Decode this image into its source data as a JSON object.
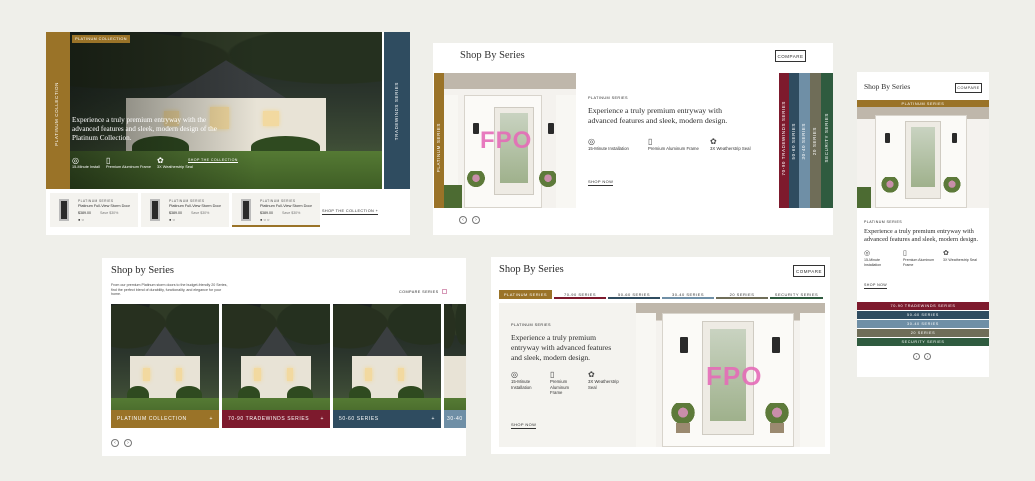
{
  "colors": {
    "platinum": "#9a7328",
    "seventy_ninety": "#7d1a2d",
    "fifty_sixty": "#2f4c60",
    "thirty_forty": "#6f8fa6",
    "twenty": "#6f6d58",
    "security": "#2f5b3f",
    "background": "#efefea"
  },
  "card1": {
    "badge": "PLATINUM COLLECTION",
    "side_label": "PLATINUM COLLECTION",
    "right_label": "TRADEWINDS SERIES",
    "headline": "Experience a truly premium entryway with the advanced features and sleek, modern design of the Platinum Collection.",
    "features": [
      {
        "icon": "timer-icon",
        "glyph": "◎",
        "label": "15-Minute Install"
      },
      {
        "icon": "frame-icon",
        "glyph": "▯",
        "label": "Premium Aluminum Frame"
      },
      {
        "icon": "seal-icon",
        "glyph": "✿",
        "label": "3X Weatherstrip Seal"
      }
    ],
    "shop_link": "SHOP THE COLLECTION",
    "products": [
      {
        "eyebrow": "PLATINUM SERIES",
        "name": "Platinum Full-View Storm Door",
        "price": "$389.00",
        "was": "Save $30%"
      },
      {
        "eyebrow": "PLATINUM SERIES",
        "name": "Platinum Full-View Storm Door",
        "price": "$389.00",
        "was": "Save $30%"
      },
      {
        "eyebrow": "PLATINUM SERIES",
        "name": "Platinum Full-View Storm Door",
        "price": "$389.00",
        "was": "Save $30%"
      }
    ],
    "products_link": "SHOP THE COLLECTION +"
  },
  "card2": {
    "title": "Shop By Series",
    "compare": "COMPARE",
    "side_label": "PLATINUM SERIES",
    "fpo": "FPO",
    "eyebrow": "PLATINUM SERIES",
    "headline": "Experience a truly premium entryway with advanced features and sleek, modern design.",
    "features": [
      {
        "icon": "timer-icon",
        "glyph": "◎",
        "label": "15-Minute Installation"
      },
      {
        "icon": "frame-icon",
        "glyph": "▯",
        "label": "Premium Aluminum Frame"
      },
      {
        "icon": "seal-icon",
        "glyph": "✿",
        "label": "3X Weatherstrip Seal"
      }
    ],
    "shop": "SHOP NOW",
    "stripes": [
      "70-90 TRADEWINDS SERIES",
      "50-60 SERIES",
      "30-40 SERIES",
      "20 SERIES",
      "SECURITY SERIES"
    ]
  },
  "card3": {
    "title": "Shop By Series",
    "compare": "COMPARE",
    "bar_top": "PLATINUM SERIES",
    "eyebrow": "PLATINUM SERIES",
    "headline": "Experience a truly premium entryway with advanced features and sleek, modern design.",
    "features": [
      {
        "icon": "timer-icon",
        "glyph": "◎",
        "label": "15-Minute Installation"
      },
      {
        "icon": "frame-icon",
        "glyph": "▯",
        "label": "Premium Aluminum Frame"
      },
      {
        "icon": "seal-icon",
        "glyph": "✿",
        "label": "3X Weatherstrip Seal"
      }
    ],
    "shop": "SHOP NOW",
    "bars": [
      "70-90 TRADEWINDS SERIES",
      "50-60 SERIES",
      "30-40 SERIES",
      "20 SERIES",
      "SECURITY SERIES"
    ]
  },
  "card4": {
    "title": "Shop by Series",
    "subtitle": "From our premium Platinum storm doors to the budget-friendly 20 Series, find the perfect blend of durability, functionality, and elegance for your home.",
    "compare": "COMPARE SERIES",
    "tiles": [
      "PLATINUM COLLECTION",
      "70-90 TRADEWINDS SERIES",
      "50-60 SERIES",
      "30-40"
    ]
  },
  "card5": {
    "title": "Shop By Series",
    "compare": "COMPARE",
    "tabs": [
      "PLATINUM SERIES",
      "70-90 SERIES",
      "50-60 SERIES",
      "30-40 SERIES",
      "20 SERIES",
      "SECURITY SERIES"
    ],
    "eyebrow": "PLATINUM SERIES",
    "headline": "Experience a truly premium entryway with advanced features and sleek, modern design.",
    "features": [
      {
        "icon": "timer-icon",
        "glyph": "◎",
        "label": "15-Minute Installation"
      },
      {
        "icon": "frame-icon",
        "glyph": "▯",
        "label": "Premium Aluminum Frame"
      },
      {
        "icon": "seal-icon",
        "glyph": "✿",
        "label": "3X Weatherstrip Seal"
      }
    ],
    "shop": "SHOP NOW",
    "fpo": "FPO"
  },
  "nav": {
    "prev": "‹",
    "next": "›"
  }
}
